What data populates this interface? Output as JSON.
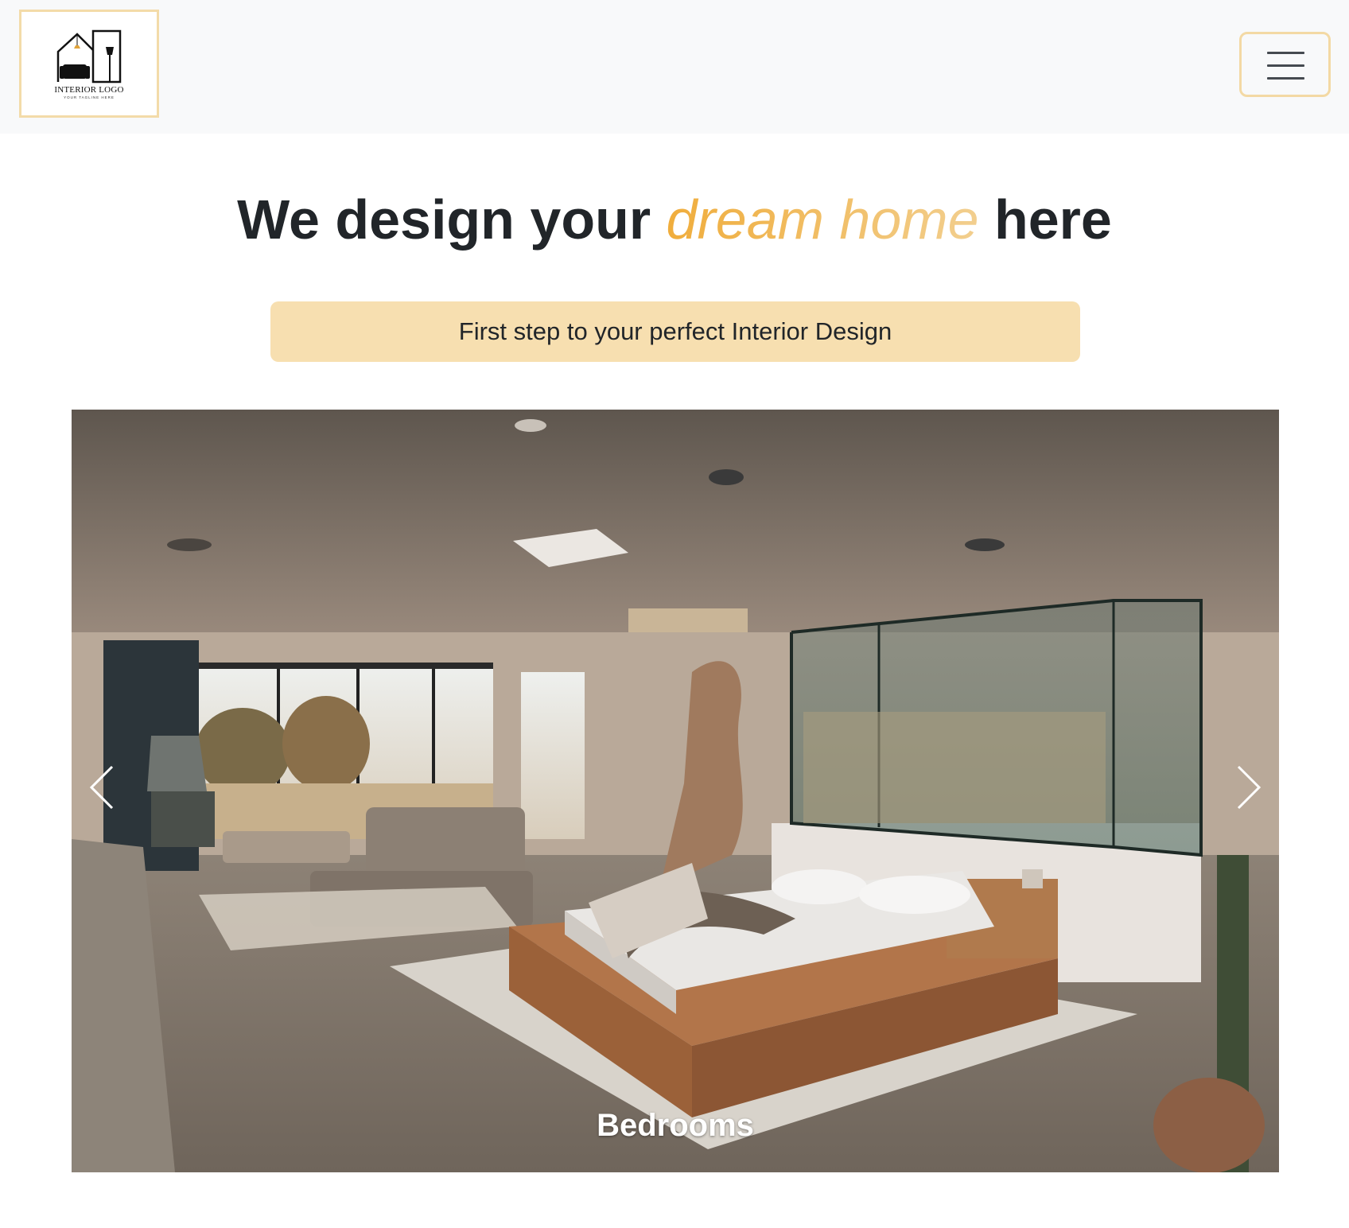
{
  "navbar": {
    "logo": {
      "title": "INTERIOR LOGO",
      "tagline": "YOUR TAGLINE HERE"
    },
    "toggler_icon": "hamburger-icon"
  },
  "hero": {
    "title_before": "We design your ",
    "title_accent": "dream home",
    "title_after": " here",
    "cta_text": "First step to your perfect Interior Design"
  },
  "carousel": {
    "caption": "Bedrooms",
    "prev_icon": "chevron-left-icon",
    "next_icon": "chevron-right-icon"
  },
  "colors": {
    "accent": "#f0ad3c",
    "accent_light": "#f2cf8f",
    "banner_bg": "#f7dfb0",
    "logo_border": "#f3dba9",
    "navbar_bg": "#f8f9fa"
  }
}
